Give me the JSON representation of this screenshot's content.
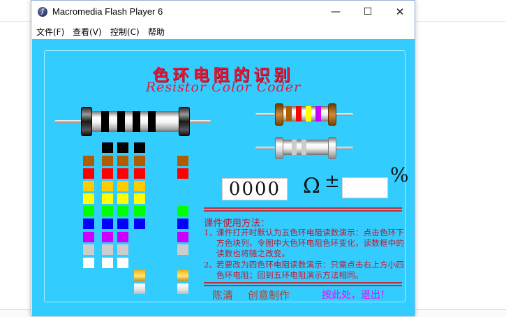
{
  "window": {
    "title": "Macromedia Flash Player 6",
    "app_icon_glyph": "f",
    "controls": {
      "minimize": "—",
      "maximize": "☐",
      "close": "✕"
    }
  },
  "menu": {
    "file": "文件(F)",
    "view": "查看(V)",
    "control": "控制(C)",
    "help": "帮助"
  },
  "app": {
    "title_cn": "色环电阻的识别",
    "title_en": "Resistor Color Coder",
    "readout": {
      "value": "0000",
      "unit": "Ω",
      "tolerance_sign": "±",
      "tolerance_value": "",
      "percent_sign": "%"
    },
    "instructions": {
      "heading": "课件使用方法：",
      "items": [
        {
          "num": "1、",
          "text": "课件打开时默认为五色环电阻读数演示：点击色环下方色块列，令图中大色环电阻色环变化，读数框中的读数也将随之改变。"
        },
        {
          "num": "2、",
          "text": "若要改为四色环电阻读数演示：只需点击右上方小四色环电阻；回到五环电阻演示方法相同。"
        }
      ]
    },
    "footer": {
      "author": "陈清",
      "credit": "创意制作",
      "quit": "按此处，退出！"
    }
  },
  "colors": {
    "stage_background": "#33ccff",
    "accent_red": "#e4183a",
    "quit_magenta": "#ff00ff",
    "footer_author": "#b53a2a",
    "footer_credit": "#b53a2a"
  },
  "swatch_palette": {
    "black": "#000000",
    "brown": "#b25c00",
    "red": "#ff0000",
    "orange": "#ffcc00",
    "yellow": "#ffff00",
    "green": "#00ff00",
    "blue": "#0000ff",
    "violet": "#cc00ff",
    "gray": "#cccccc",
    "white": "#ffffff",
    "gold": "gold-gradient",
    "silver": "silver-gradient"
  },
  "large_resistor_bands": [
    "black",
    "black",
    "black",
    "black"
  ],
  "small_resistor_4band": [
    "brown",
    "red",
    "yellow",
    "violet"
  ],
  "small_resistor_plain_bands": [
    "gray",
    "gray"
  ]
}
